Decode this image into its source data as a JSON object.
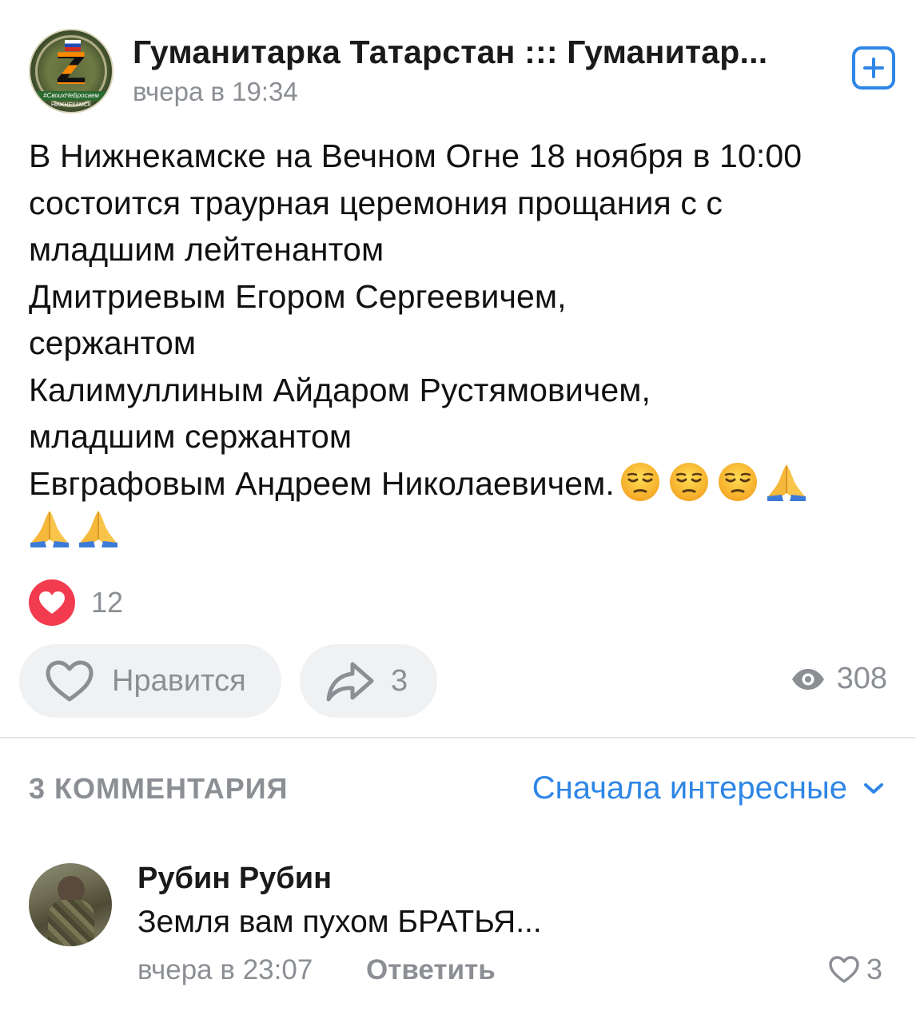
{
  "post": {
    "group_name": "Гуманитарка Татарстан ::: Гуманитар...",
    "time": "вчера в 19:34",
    "avatar": {
      "label": "#СвоихНеБросаем",
      "city": "НИЖНЕКАМСК"
    },
    "text_lines": [
      "В Нижнекамске на Вечном Огне 18 ноября в 10:00",
      "состоится траурная церемония прощания с с",
      "младшим лейтенантом",
      "Дмитриевым Егором Сергеевичем,",
      "сержантом",
      "Калимуллиным Айдаром Рустямовичем,",
      "младшим сержантом",
      "Евграфовым Андреем Николаевичем."
    ],
    "emojis_line1": [
      "pensive-face",
      "pensive-face",
      "pensive-face",
      "folded-hands"
    ],
    "emojis_line2": [
      "folded-hands",
      "folded-hands"
    ],
    "reactions": {
      "count": "12",
      "color": "#f23b4f"
    },
    "actions": {
      "like_label": "Нравится",
      "share_count": "3",
      "views_count": "308"
    }
  },
  "comments_section": {
    "count_label": "3 КОММЕНТАРИЯ",
    "sort_label": "Сначала интересные",
    "accent_color": "#2e86e6",
    "items": [
      {
        "author": "Рубин Рубин",
        "text": "Земля вам пухом БРАТЬЯ...",
        "time": "вчера в 23:07",
        "reply_label": "Ответить",
        "like_count": "3"
      }
    ]
  }
}
